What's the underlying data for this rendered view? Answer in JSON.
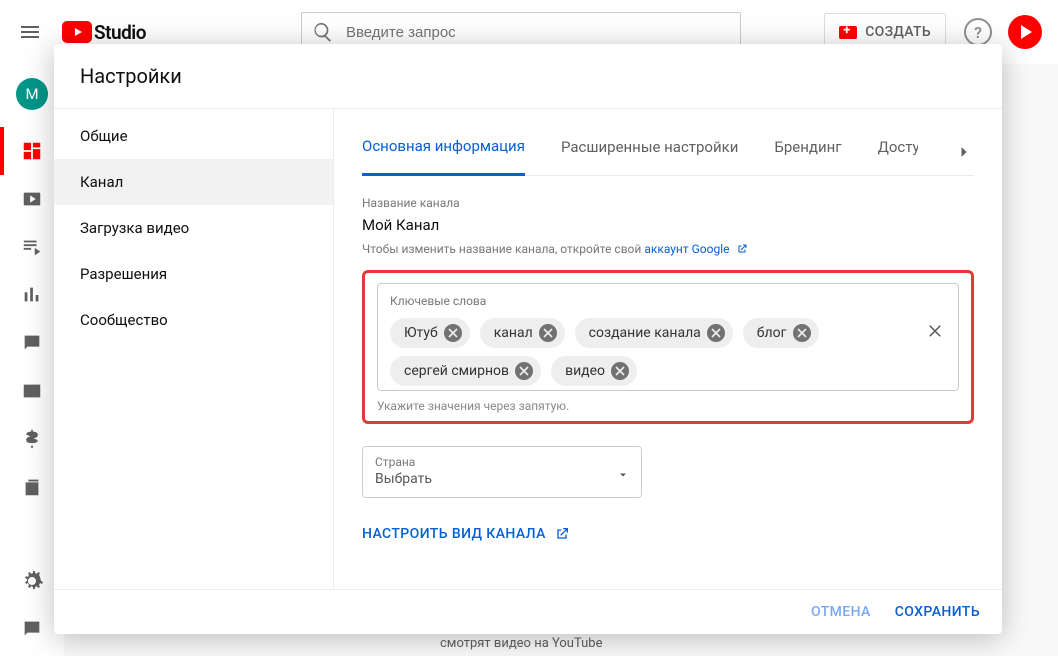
{
  "topbar": {
    "logo_text": "Studio",
    "search_placeholder": "Введите запрос",
    "create_label": "СОЗДАТЬ",
    "avatar_letter": "M"
  },
  "modal": {
    "title": "Настройки",
    "sidebar": [
      {
        "label": "Общие"
      },
      {
        "label": "Канал"
      },
      {
        "label": "Загрузка видео"
      },
      {
        "label": "Разрешения"
      },
      {
        "label": "Сообщество"
      }
    ],
    "tabs": [
      {
        "label": "Основная информация"
      },
      {
        "label": "Расширенные настройки"
      },
      {
        "label": "Брендинг"
      },
      {
        "label": "Доступ"
      }
    ],
    "channel_name_label": "Название канала",
    "channel_name": "Мой Канал",
    "channel_name_hint_prefix": "Чтобы изменить название канала, откройте свой ",
    "channel_name_hint_link": "аккаунт Google",
    "keywords_label": "Ключевые слова",
    "keywords": [
      "Ютуб",
      "канал",
      "создание канала",
      "блог",
      "сергей смирнов",
      "видео"
    ],
    "keywords_hint": "Укажите значения через запятую.",
    "country_label": "Страна",
    "country_value": "Выбрать",
    "customize_link": "НАСТРОИТЬ ВИД КАНАЛА",
    "cancel": "ОТМЕНА",
    "save": "СОХРАНИТЬ"
  },
  "bg": {
    "snippet": "смотрят видео на YouTube"
  }
}
